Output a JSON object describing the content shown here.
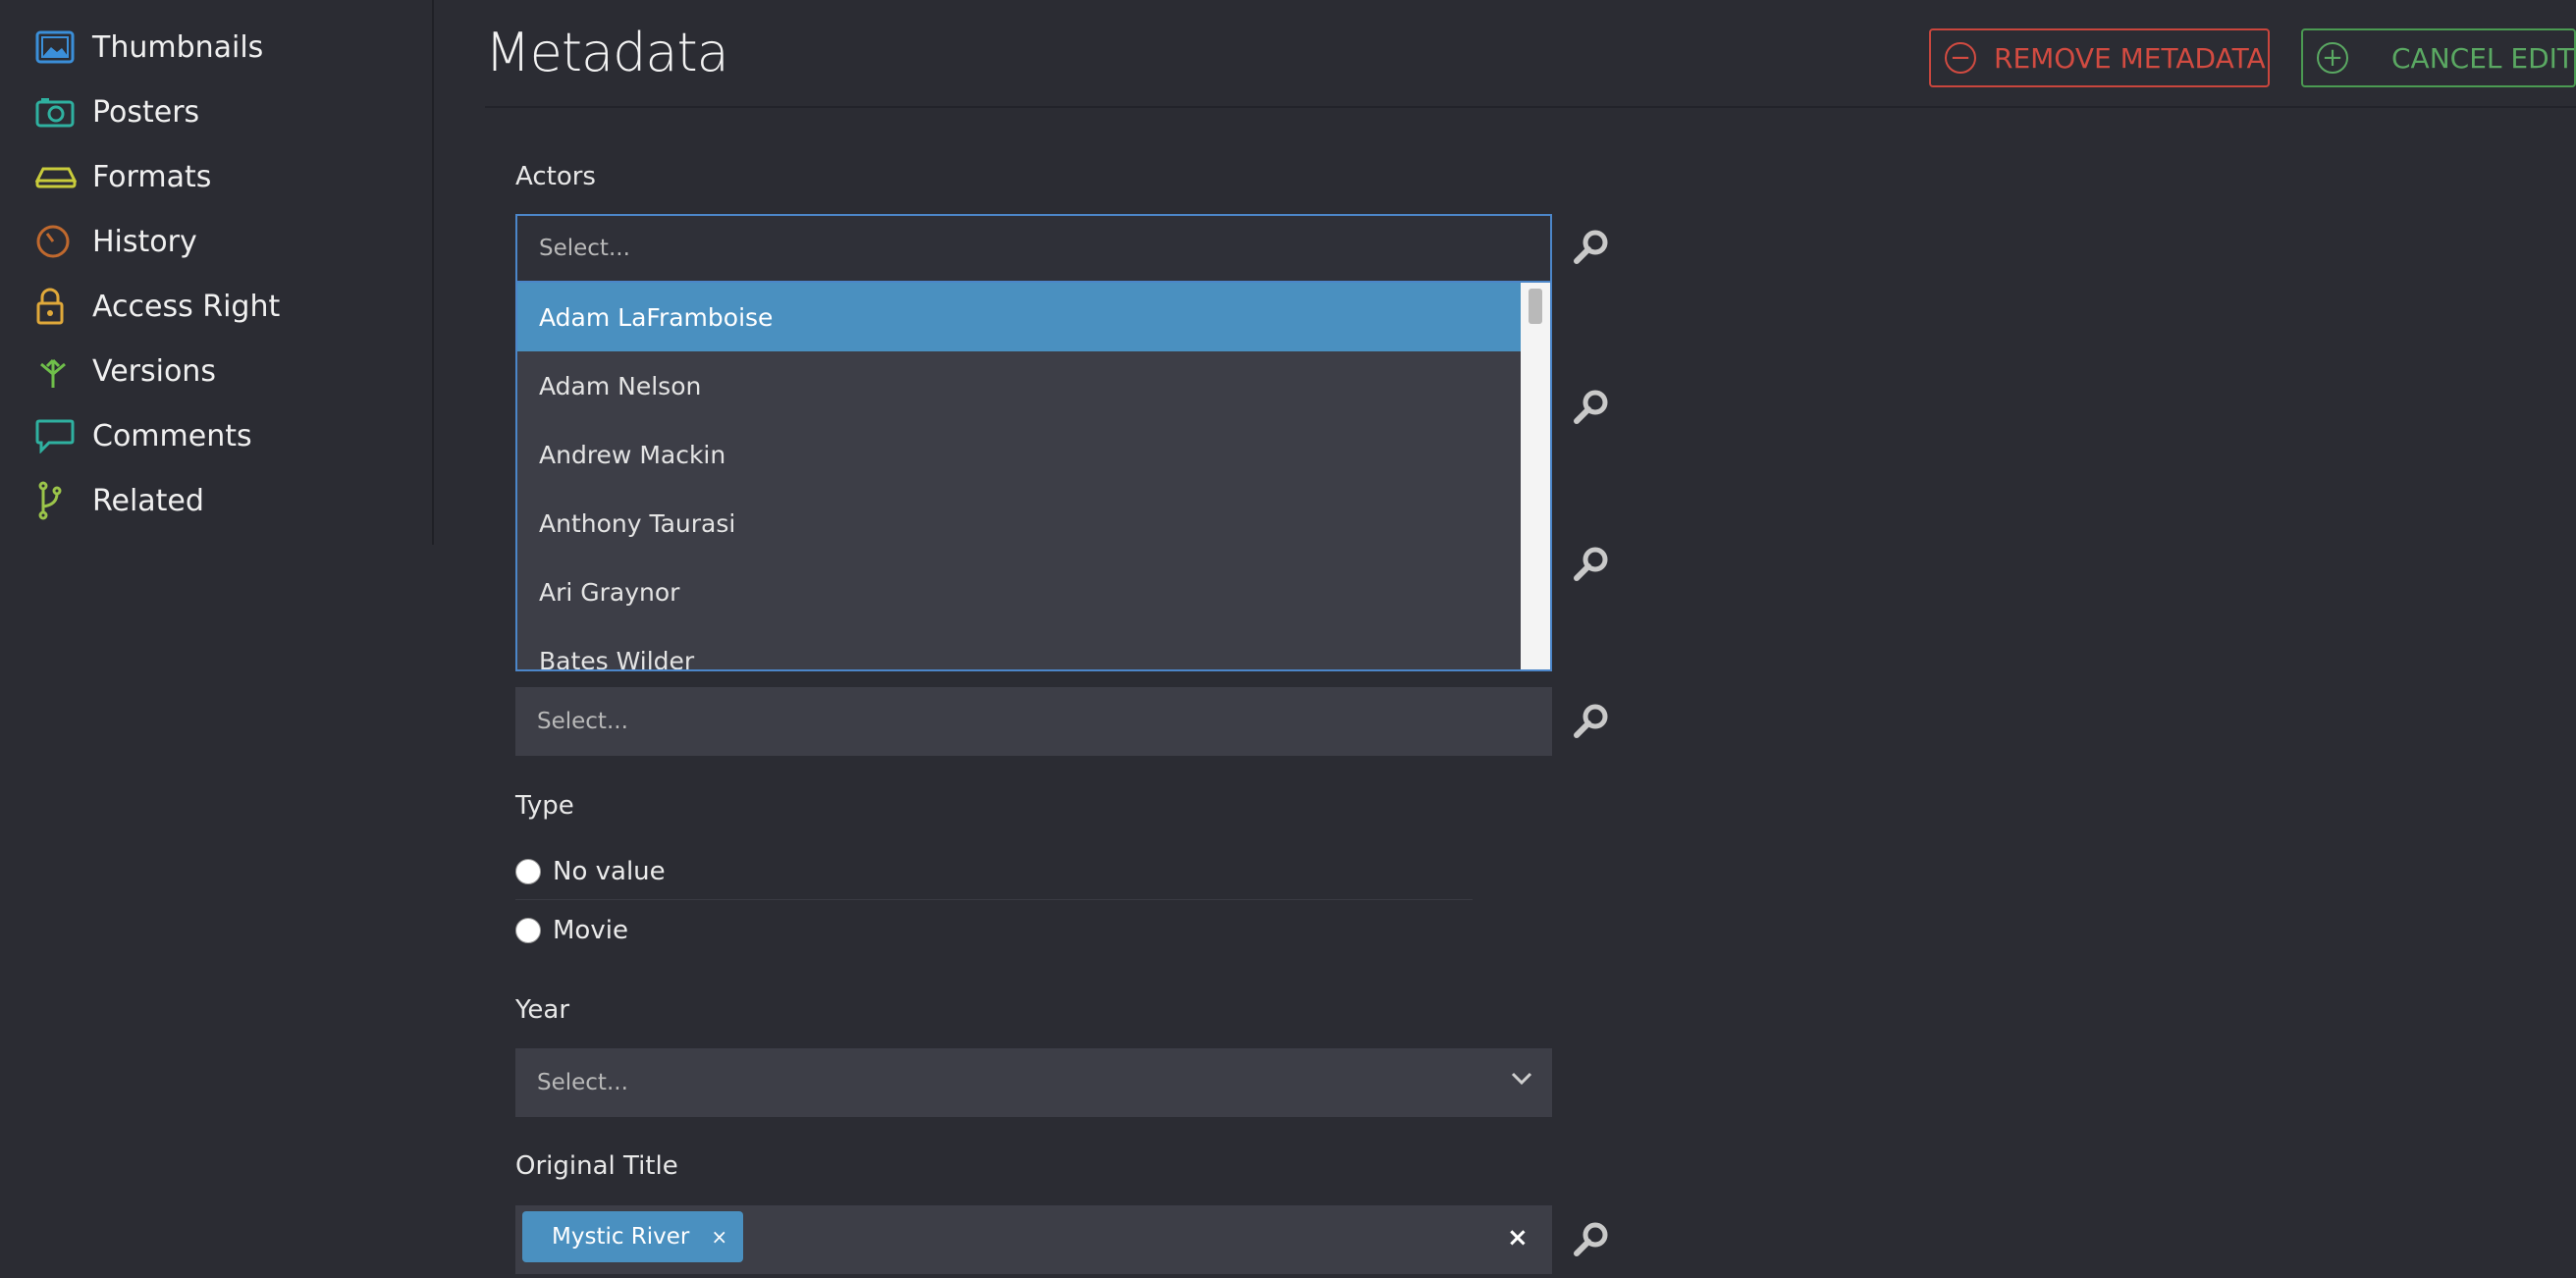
{
  "sidebar": {
    "items": [
      {
        "label": "Thumbnails",
        "icon": "image-icon",
        "color": "#3b8fd9"
      },
      {
        "label": "Posters",
        "icon": "camera-icon",
        "color": "#2fb1a0"
      },
      {
        "label": "Formats",
        "icon": "hard-drive-icon",
        "color": "#c9cc3b"
      },
      {
        "label": "History",
        "icon": "clock-icon",
        "color": "#c0692e"
      },
      {
        "label": "Access Right",
        "icon": "lock-icon",
        "color": "#e0a93a"
      },
      {
        "label": "Versions",
        "icon": "branch-arrows-icon",
        "color": "#6fbf4a"
      },
      {
        "label": "Comments",
        "icon": "speech-bubble-icon",
        "color": "#2fb1a0"
      },
      {
        "label": "Related",
        "icon": "git-branch-icon",
        "color": "#9bc44a"
      }
    ]
  },
  "header": {
    "title": "Metadata",
    "remove_label": "REMOVE METADATA",
    "cancel_label": "CANCEL EDIT",
    "remove_color": "#d24b41",
    "cancel_color": "#5aa862"
  },
  "form": {
    "actors": {
      "label": "Actors",
      "placeholder": "Select...",
      "options": [
        "Adam LaFramboise",
        "Adam Nelson",
        "Andrew Mackin",
        "Anthony Taurasi",
        "Ari Graynor",
        "Bates Wilder"
      ],
      "highlighted": "Adam LaFramboise"
    },
    "hidden_select_placeholder": "Select...",
    "type": {
      "label": "Type",
      "options": [
        "No value",
        "Movie"
      ]
    },
    "year": {
      "label": "Year",
      "placeholder": "Select..."
    },
    "original_title": {
      "label": "Original Title",
      "tags": [
        "Mystic River"
      ],
      "clear": "×",
      "tag_remove": "×"
    }
  }
}
